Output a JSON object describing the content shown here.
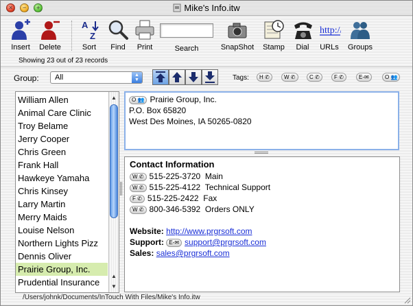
{
  "window": {
    "title": "Mike's Info.itw"
  },
  "toolbar": {
    "insert": "Insert",
    "delete": "Delete",
    "sort": "Sort",
    "find": "Find",
    "print": "Print",
    "search": "Search",
    "snapshot": "SnapShot",
    "stamp": "Stamp",
    "dial": "Dial",
    "urls": "URLs",
    "groups": "Groups"
  },
  "status": {
    "record_count": "Showing 23 out of 23 records"
  },
  "group": {
    "label": "Group:",
    "selected": "All"
  },
  "tags": {
    "label": "Tags:",
    "items": [
      "H",
      "W",
      "C",
      "F",
      "E-",
      "O"
    ]
  },
  "list": {
    "items": [
      "William Allen",
      "Animal Care Clinic",
      "Troy Belame",
      "Jerry Cooper",
      "Chris Green",
      "Frank Hall",
      "Hawkeye Yamaha",
      "Chris Kinsey",
      "Larry Martin",
      "Merry Maids",
      "Louise Nelson",
      "Northern Lights Pizz",
      "Dennis Oliver",
      "Prairie Group, Inc.",
      "Prudential Insurance"
    ],
    "selected_index": 13
  },
  "address": {
    "tag": "O",
    "name": "Prairie Group, Inc.",
    "line1": "P.O. Box 65820",
    "line2": "West Des Moines, IA 50265-0820"
  },
  "contact": {
    "heading": "Contact Information",
    "phones": [
      {
        "tag": "W",
        "number": "515-225-3720",
        "label": "Main"
      },
      {
        "tag": "W",
        "number": "515-225-4122",
        "label": "Technical Support"
      },
      {
        "tag": "F",
        "number": "515-225-2422",
        "label": "Fax"
      },
      {
        "tag": "W",
        "number": "800-346-5392",
        "label": "Orders ONLY"
      }
    ],
    "website_label": "Website:",
    "website": "http://www.prgrsoft.com",
    "support_label": "Support:",
    "support_tag": "E-",
    "support": "support@prgrsoft.com",
    "sales_label": "Sales:",
    "sales": "sales@prgrsoft.com"
  },
  "pathbar": {
    "path": "/Users/johnk/Documents/InTouch With Files/Mike's Info.itw"
  },
  "colors": {
    "selection": "#d6ecae",
    "link": "#1a2fd6",
    "focus": "#8ab0e8"
  }
}
